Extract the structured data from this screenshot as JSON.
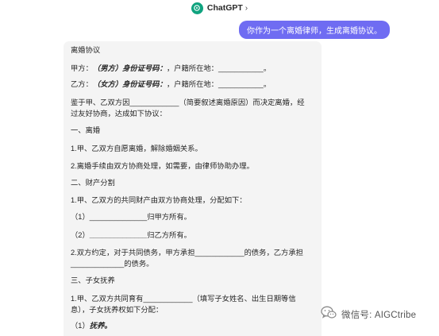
{
  "header": {
    "app_title": "ChatGPT",
    "chevron": "›",
    "logo_icon": "openai-logo-icon"
  },
  "user_message": "你作为一个离婚律师，生成离婚协议。",
  "reply": {
    "title": "离婚协议",
    "party_a": {
      "prefix": "甲方：",
      "role": "（男方）",
      "id_label": "身份证号码：",
      "address_label": "，户籍所在地：",
      "blank": "___________",
      "end": "。"
    },
    "party_b": {
      "prefix": "乙方：",
      "role": "（女方）",
      "id_label": "身份证号码：",
      "address_label": "，户籍所在地：",
      "blank": "___________",
      "end": "。"
    },
    "preamble_1_pre": "鉴于甲、乙双方因",
    "preamble_1_blank": "____________",
    "preamble_1_post": "（简要叙述离婚原因）而决定离婚，经",
    "preamble_2": "过友好协商，达成如下协议：",
    "s1_heading": "一、离婚",
    "s1_item1": "1.甲、乙双方自愿离婚，解除婚姻关系。",
    "s1_item2": "2.离婚手续由双方协商处理，如需要，由律师协助办理。",
    "s2_heading": "二、财产分割",
    "s2_item1": "1.甲、乙双方的共同财产由双方协商处理，分配如下：",
    "s2_sub1_pre": "（1）",
    "s2_sub1_blank": "______________",
    "s2_sub1_post": "归甲方所有。",
    "s2_sub2_pre": "（2）",
    "s2_sub2_blank": "______________",
    "s2_sub2_post": "归乙方所有。",
    "s2_item2_pre": "2.双方约定，对于共同债务，甲方承担",
    "s2_item2_blank1": "____________",
    "s2_item2_mid": "的债务，乙方承担",
    "s2_item2_blank2": "_____________",
    "s2_item2_post": "的债务。",
    "s3_heading": "三、子女抚养",
    "s3_item1_pre": "1.甲、乙双方共同育有",
    "s3_item1_blank": "____________",
    "s3_item1_post": "（填写子女姓名、出生日期等信",
    "s3_item1_line2": "息），子女抚养权如下分配：",
    "s3_sub1_pre": "（1）",
    "s3_sub1_bold": "抚养。"
  },
  "watermark": {
    "icon": "wechat-icon",
    "text": "微信号: AIGCtribe"
  },
  "colors": {
    "user_bubble": "#6f6cf2",
    "reply_bg": "#f4f4f4",
    "logo": "#10a37f"
  }
}
